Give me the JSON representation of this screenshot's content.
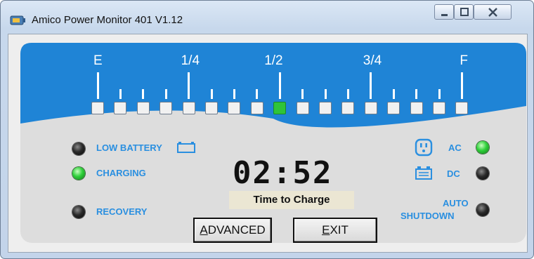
{
  "window": {
    "title": "Amico Power Monitor 401 V1.12",
    "controls": [
      "minimize",
      "maximize",
      "close"
    ]
  },
  "gauge": {
    "labels": [
      {
        "key": "empty",
        "text": "E"
      },
      {
        "key": "quarter",
        "text": "1/4"
      },
      {
        "key": "half",
        "text": "1/2"
      },
      {
        "key": "three-quarter",
        "text": "3/4"
      },
      {
        "key": "full",
        "text": "F"
      }
    ],
    "segment_count": 17,
    "active_segment": 9,
    "level_fraction": 0.5
  },
  "indicators": {
    "low_battery": {
      "label": "LOW BATTERY",
      "state": "off"
    },
    "charging": {
      "label": "CHARGING",
      "state": "on"
    },
    "recovery": {
      "label": "RECOVERY",
      "state": "off"
    },
    "ac": {
      "label": "AC",
      "state": "on"
    },
    "dc": {
      "label": "DC",
      "state": "off"
    },
    "auto_shutdown": {
      "label_line1": "AUTO",
      "label_line2": "SHUTDOWN",
      "state": "off"
    }
  },
  "display": {
    "time": "02:52",
    "caption": "Time to Charge"
  },
  "buttons": {
    "advanced": "ADVANCED",
    "exit": "EXIT"
  },
  "colors": {
    "panel_blue": "#1f84d6",
    "label_blue": "#2a8fe0",
    "led_on": "#2fd03a",
    "led_off": "#111111"
  }
}
